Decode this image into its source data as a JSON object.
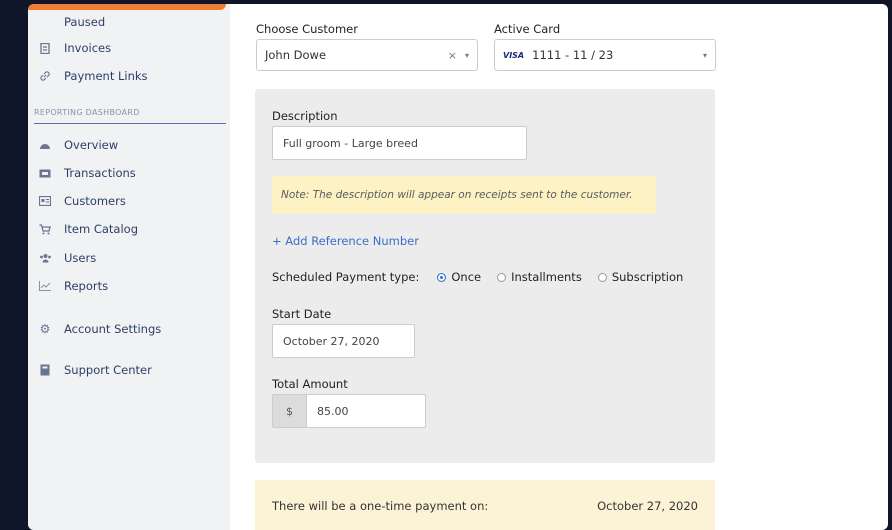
{
  "sidebar": {
    "paused": "Paused",
    "invoices": "Invoices",
    "payment_links": "Payment Links",
    "section_label": "REPORTING DASHBOARD",
    "overview": "Overview",
    "transactions": "Transactions",
    "customers": "Customers",
    "item_catalog": "Item Catalog",
    "users": "Users",
    "reports": "Reports",
    "account_settings": "Account Settings",
    "support_center": "Support Center"
  },
  "form": {
    "choose_customer_label": "Choose Customer",
    "customer_value": "John Dowe",
    "customer_clear": "×",
    "active_card_label": "Active Card",
    "card_brand": "VISA",
    "card_value": "1111  -  11 / 23",
    "description_label": "Description",
    "description_value": "Full groom - Large breed",
    "note": "Note: The description will appear on receipts sent to the customer.",
    "add_reference": "+ Add Reference Number",
    "payment_type_label": "Scheduled Payment type:",
    "payment_type_options": [
      "Once",
      "Installments",
      "Subscription"
    ],
    "payment_type_selected": "Once",
    "start_date_label": "Start Date",
    "start_date_value": "October 27, 2020",
    "total_amount_label": "Total Amount",
    "currency_symbol": "$",
    "total_amount_value": "85.00"
  },
  "summary": {
    "text": "There will be a one-time payment on:",
    "date": "October 27, 2020"
  },
  "colors": {
    "accent": "#f07d36",
    "link": "#3b6ec9",
    "note_bg": "#fcf2c4",
    "background": "#0f1629"
  }
}
